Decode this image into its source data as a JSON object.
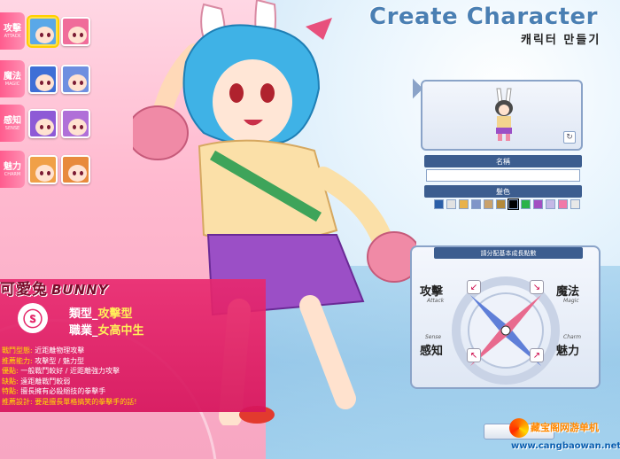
{
  "screen": {
    "title": "Create Character",
    "subtitle": "캐릭터 만들기"
  },
  "categories": [
    {
      "zh": "攻擊",
      "en": "ATTACK"
    },
    {
      "zh": "魔法",
      "en": "MAGIC"
    },
    {
      "zh": "感知",
      "en": "SENSE"
    },
    {
      "zh": "魅力",
      "en": "CHARM"
    }
  ],
  "character": {
    "name_zh": "可愛兔",
    "name_en": "BUNNY",
    "type_label": "類型_",
    "type_value": "攻擊型",
    "job_label": "職業_",
    "job_value": "女高中生",
    "desc": [
      {
        "k": "戰鬥型態:",
        "v": "近距離物理攻擊"
      },
      {
        "k": "推薦能力:",
        "v": "攻擊型 / 魅力型"
      },
      {
        "k": "優點:",
        "v": "一般戰鬥較好 / 近距離強力攻擊"
      },
      {
        "k": "缺點:",
        "v": "遠距離戰鬥較弱"
      },
      {
        "k": "特點:",
        "v": "擅長擁有必殺絕技的拳擊手"
      },
      {
        "k": "推薦設計:",
        "v": "要是擅長單格搞笑的拳擊手的話!"
      }
    ]
  },
  "panel": {
    "name_header": "名稱",
    "name_value": "",
    "color_header": "髮色",
    "swatches": [
      "#2b5fa8",
      "#e2e2e2",
      "#e8b24a",
      "#7f95c8",
      "#c9a26b",
      "#b48a3a",
      "#000000",
      "#2ab34a",
      "#a24fc2",
      "#c4b8e6",
      "#f07aa8",
      "#e8e8e8"
    ],
    "stat_title": "請分配基本成長點數",
    "stats": [
      {
        "zh": "攻擊",
        "en": "Attack"
      },
      {
        "zh": "魔法",
        "en": "Magic"
      },
      {
        "zh": "感知",
        "en": "Sense"
      },
      {
        "zh": "魅力",
        "en": "Charm"
      }
    ]
  },
  "watermark": {
    "cn": "藏宝阁网游单机",
    "url": "www.cangbaowan.net"
  }
}
